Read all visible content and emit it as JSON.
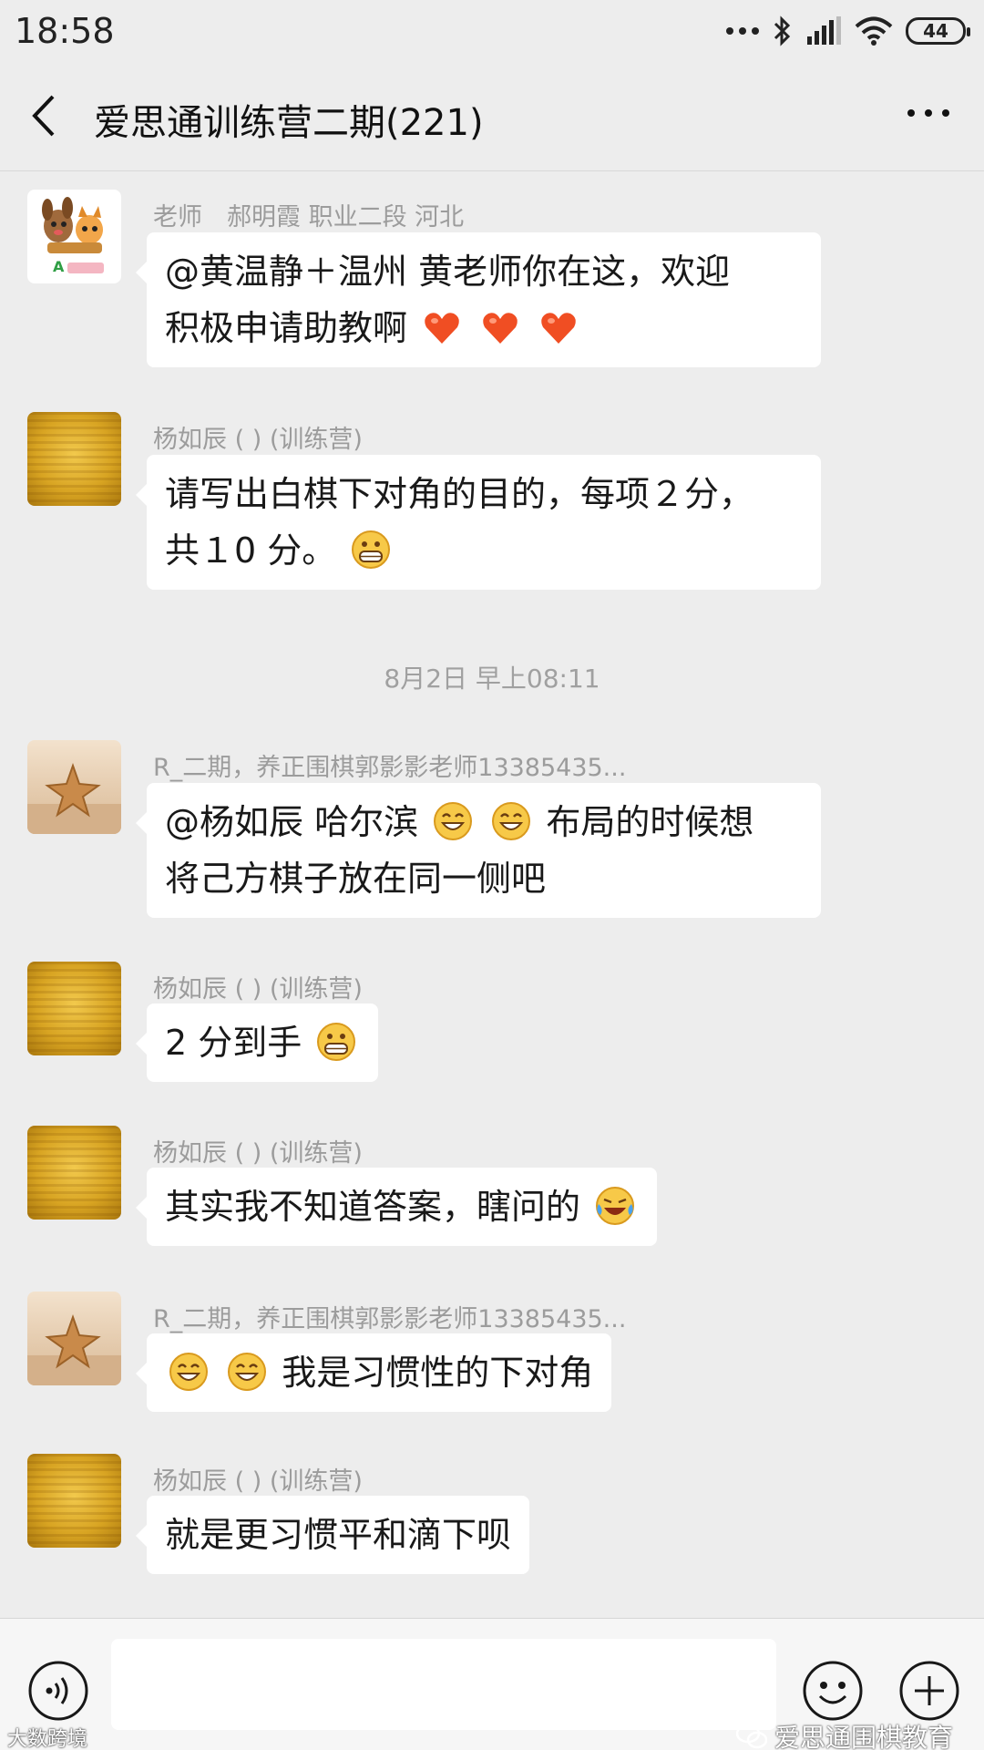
{
  "status_bar": {
    "time": "18:58",
    "battery": "44"
  },
  "header": {
    "title": "爱思通训练营二期(221)"
  },
  "messages": [
    {
      "sender": "老师　郝明霞 职业二段 河北",
      "text_before": "@黄温静＋温州  黄老师你在这，欢迎",
      "text_line2": "积极申请助教啊",
      "emojis": [
        "heart",
        "heart",
        "heart"
      ],
      "avatar": "cartoon"
    },
    {
      "sender": "杨如辰 ( ) (训练营)",
      "text_line1": "请写出白棋下对角的目的，每项２分，",
      "text_line2": "共１0 分。",
      "emoji": "grin",
      "avatar": "gold"
    },
    {
      "sender": "R_二期，养正围棋郭影影老师13385435...",
      "text_line1_a": "@杨如辰 哈尔滨",
      "text_line1_b": "布局的时候想",
      "text_line2": "将己方棋子放在同一侧吧",
      "emojis": [
        "smile",
        "smile"
      ],
      "avatar": "starfish"
    },
    {
      "sender": "杨如辰 ( ) (训练营)",
      "text": "2 分到手",
      "emoji": "grin",
      "avatar": "gold"
    },
    {
      "sender": "杨如辰 ( ) (训练营)",
      "text": "其实我不知道答案，瞎问的",
      "emoji": "laugh-cry",
      "avatar": "gold"
    },
    {
      "sender": "R_二期，养正围棋郭影影老师13385435...",
      "text": "我是习惯性的下对角",
      "emojis": [
        "smile",
        "smile"
      ],
      "avatar": "starfish"
    },
    {
      "sender": "杨如辰 ( ) (训练营)",
      "text": "就是更习惯平和滴下呗",
      "avatar": "gold"
    }
  ],
  "time_divider": "8月2日 早上08:11",
  "watermarks": {
    "right": "爱思通围棋教育",
    "left": "大数跨境"
  },
  "colors": {
    "background": "#ededed",
    "bubble": "#ffffff",
    "sender": "#9c9c9c"
  }
}
